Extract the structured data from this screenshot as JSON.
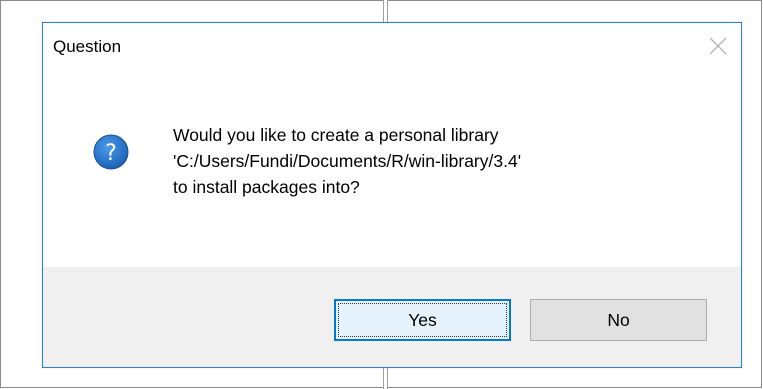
{
  "dialog": {
    "title": "Question",
    "close_icon": "close-icon",
    "question_icon": "question-mark-icon",
    "message_lines": [
      "Would you like to create a personal library",
      "'C:/Users/Fundi/Documents/R/win-library/3.4'",
      "to install packages into?"
    ],
    "buttons": {
      "yes": "Yes",
      "no": "No"
    },
    "default_button": "yes"
  },
  "colors": {
    "dialog_border": "#2b7cd3",
    "footer_bg": "#f0f0f0",
    "icon_blue": "#1f6fc5",
    "default_button_border": "#0078d7"
  }
}
